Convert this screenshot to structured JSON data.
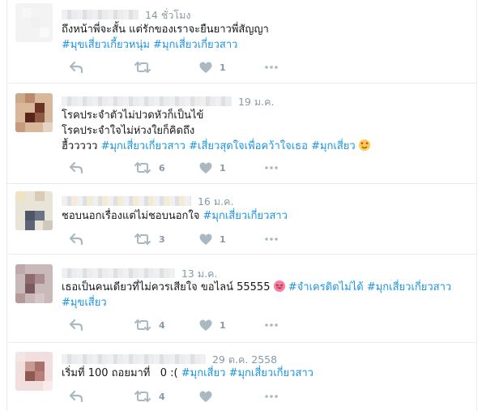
{
  "icon_color": "#aab8c2",
  "hashtag_color": "#1b95e0",
  "tweets": [
    {
      "time": "14 ชั่วโมง",
      "line1": "ถึงหน้าพี่จะสั้น แต่รักของเราจะยืนยาวพี่สัญญา",
      "tags": [
        "#มุขเสี่ยวเกี้ยวหนุ่ม",
        "#มุกเสี่ยวเกี่ยวสาว"
      ],
      "retweets": "",
      "likes": "1"
    },
    {
      "time": "19 ม.ค.",
      "line1": "โรคประจำตัวไม่ปวดหัวก็เป็นไข้",
      "line2": "โรคประจำใจไม่ห่วงใยก็คิดถึง",
      "line3_prefix": "ฮื้ววววว",
      "tags": [
        "#มุกเสี่ยวเกี่ยวสาว",
        "#เสี่ยวสุดใจเพื่อคว้าใจเธอ",
        "#มุกเสี่ยว"
      ],
      "emoji": "heart-eyes",
      "retweets": "6",
      "likes": "1"
    },
    {
      "time": "16 ม.ค.",
      "line1": "ชอบนอกเรื่องแต่ไม่ชอบนอกใจ",
      "tags": [
        "#มุกเสี่ยวเกี่ยวสาว"
      ],
      "retweets": "3",
      "likes": "1"
    },
    {
      "time": "13 ม.ค.",
      "line1": "เธอเป็นคนเดียวที่ไม่ควรเสียใจ ขอไลน์ 55555",
      "emoji": "tongue-wink",
      "tags": [
        "#จำเครดิตไม่ได้",
        "#มุกเสี่ยวเกี่ยวสาว",
        "#มุขเสี่ยว"
      ],
      "retweets": "4",
      "likes": "1"
    },
    {
      "time": "29 ต.ค. 2558",
      "line1": "เริ่มที่ 100 ถอยมาที่   0 :(",
      "tags": [
        "#มุกเสี่ยว",
        "#มุกเสี่ยวเกี่ยวสาว"
      ],
      "retweets": "4",
      "likes": ""
    }
  ]
}
